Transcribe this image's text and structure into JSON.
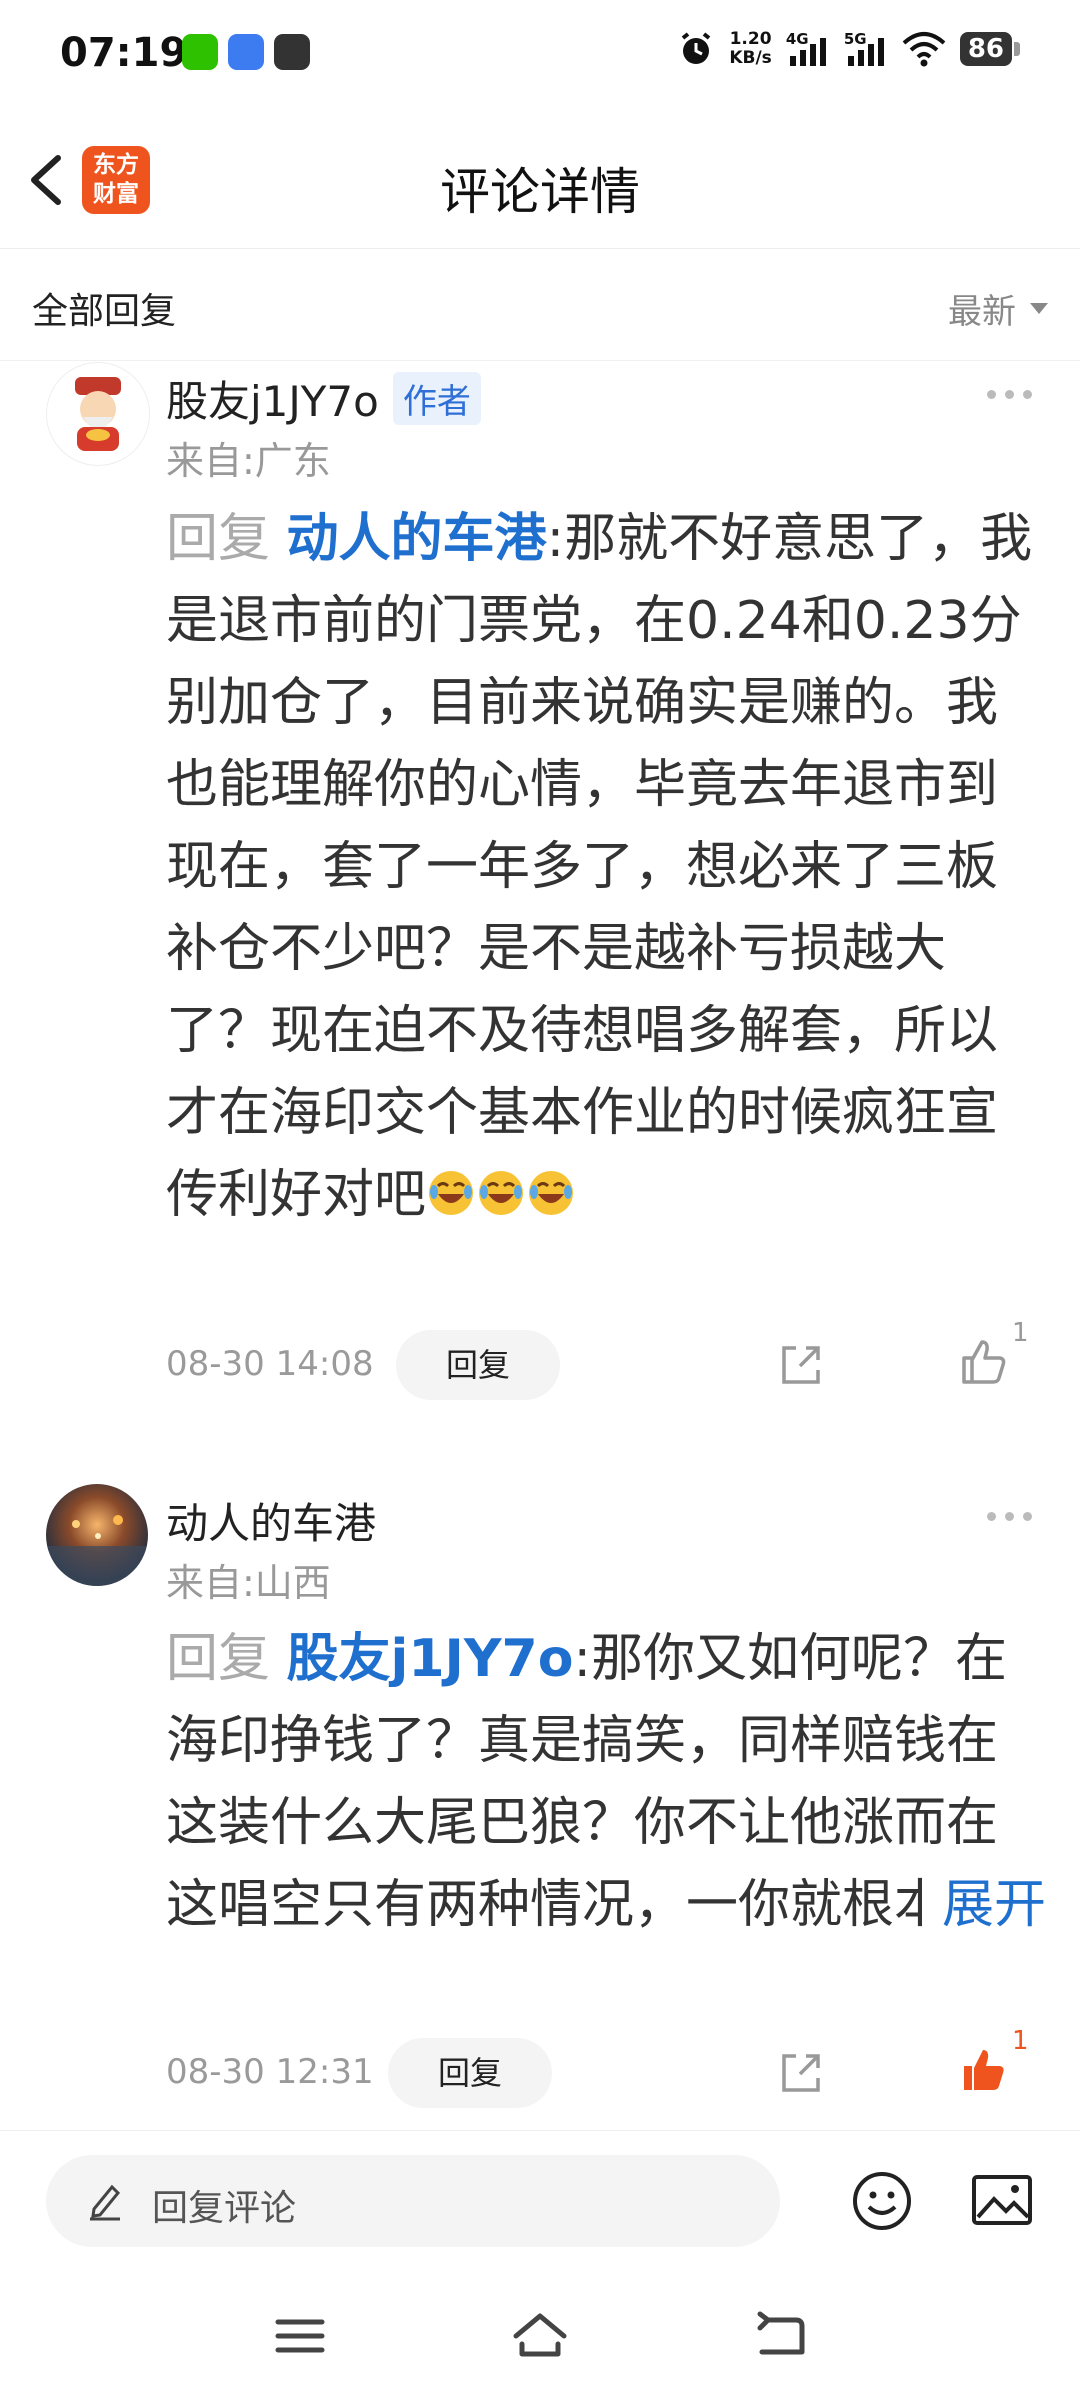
{
  "status_bar": {
    "time": "07:19",
    "speed_value": "1.20",
    "speed_unit": "KB/s",
    "net1": "4G",
    "net2": "5G",
    "battery": "86"
  },
  "header": {
    "logo_line1": "东方",
    "logo_line2": "财富",
    "title": "评论详情",
    "logo_color": "#f0541e"
  },
  "filter": {
    "label": "全部回复",
    "sort": "最新"
  },
  "comments": [
    {
      "username": "股友j1JY7o",
      "author_tag": "作者",
      "location": "来自:广东",
      "reply_prefix": "回复",
      "reply_to": "动人的车港",
      "text": ":那就不好意思了，我是退市前的门票党，在0.24和0.23分别加仓了，目前来说确实是赚的。我也能理解你的心情，毕竟去年退市到现在，套了一年多了，想必来了三板补仓不少吧？是不是越补亏损越大了？现在迫不及待想唱多解套，所以才在海印交个基本作业的时候疯狂宣传利好对吧",
      "time": "08-30 14:08",
      "reply_button": "回复",
      "likes": "1",
      "liked": false
    },
    {
      "username": "动人的车港",
      "location": "来自:山西",
      "reply_prefix": "回复",
      "reply_to": "股友j1JY7o",
      "text": ":那你又如何呢？在海印挣钱了？真是搞笑，同样赔钱在这装什么大尾巴狼？你不让他涨而在这唱空只有两种情况，一你就根本没仓位，即便有也 …",
      "expand": "展开",
      "time": "08-30 12:31",
      "reply_button": "回复",
      "likes": "1",
      "liked": true
    }
  ],
  "bottom": {
    "placeholder": "回复评论"
  },
  "colors": {
    "accent_blue": "#1f6fcf",
    "like_orange": "#f0541e"
  }
}
